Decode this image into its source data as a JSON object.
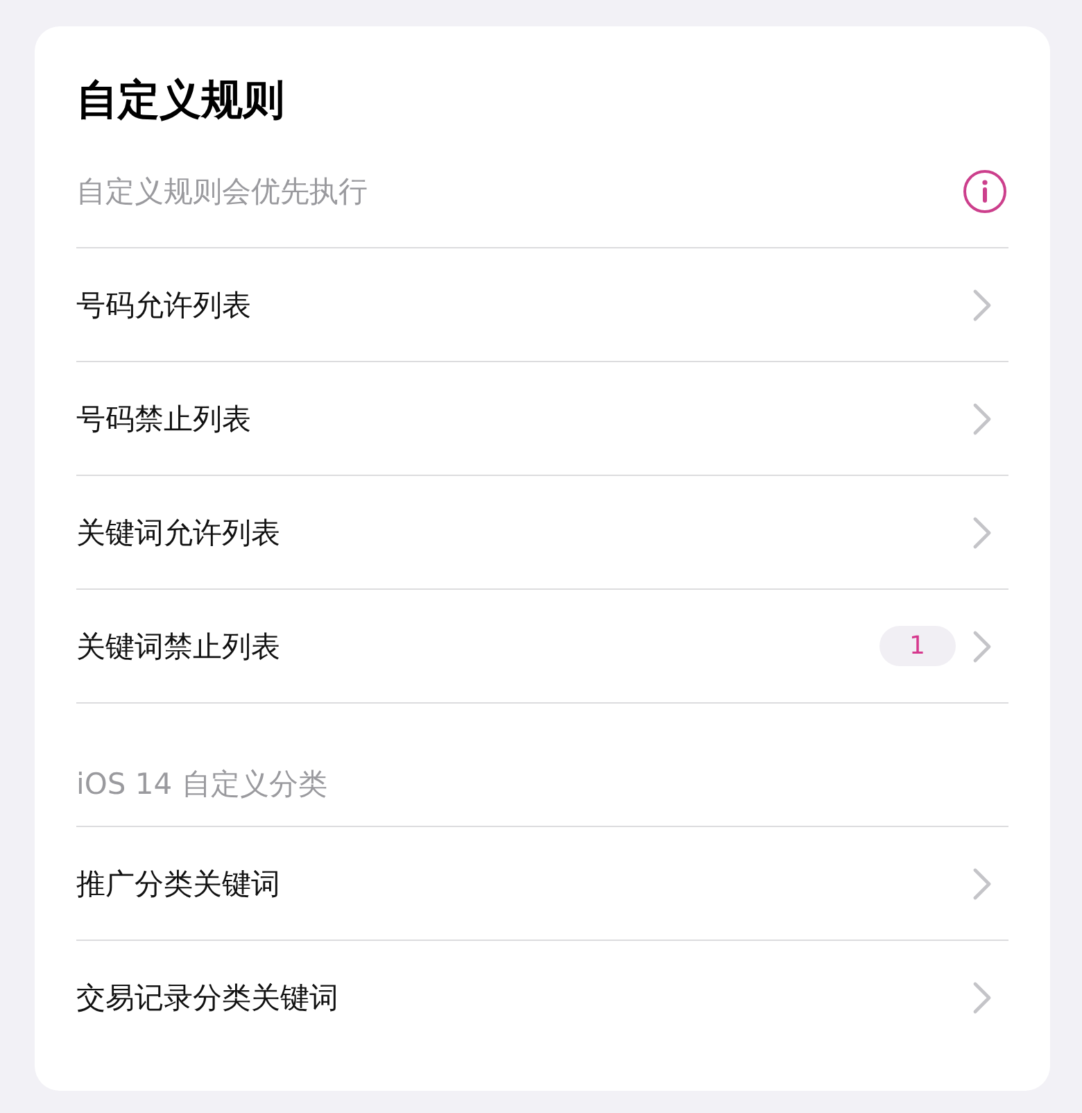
{
  "title": "自定义规则",
  "sections": [
    {
      "header": "自定义规则会优先执行",
      "info": true,
      "items": [
        {
          "label": "号码允许列表"
        },
        {
          "label": "号码禁止列表"
        },
        {
          "label": "关键词允许列表"
        },
        {
          "label": "关键词禁止列表",
          "badge": "1"
        }
      ]
    },
    {
      "header": "iOS 14 自定义分类",
      "info": false,
      "items": [
        {
          "label": "推广分类关键词"
        },
        {
          "label": "交易记录分类关键词"
        }
      ]
    }
  ]
}
